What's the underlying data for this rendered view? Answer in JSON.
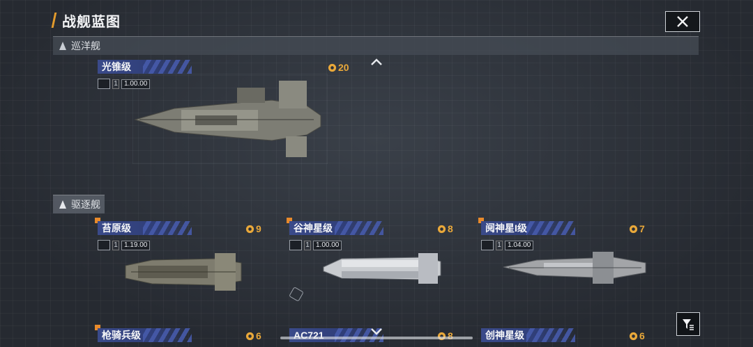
{
  "header": {
    "title": "战舰蓝图"
  },
  "sections": {
    "cruiser": {
      "label": "巡洋舰"
    },
    "destroyer": {
      "label": "驱逐舰"
    }
  },
  "ships": {
    "guangzhui": {
      "name": "光锥级",
      "cost": "20",
      "level": "1",
      "value": "1.00.00"
    },
    "taiyuan": {
      "name": "苔原级",
      "cost": "9",
      "level": "1",
      "value": "1.19.00"
    },
    "gushen": {
      "name": "谷神星级",
      "cost": "8",
      "level": "1",
      "value": "1.00.00"
    },
    "yueshen": {
      "name": "阋神星I级",
      "cost": "7",
      "level": "1",
      "value": "1.04.00"
    },
    "qiangqi": {
      "name": "枪骑兵级",
      "cost": "6"
    },
    "ac721": {
      "name": "AC721",
      "cost": "8"
    },
    "chuangshen": {
      "name": "创神星级",
      "cost": "6"
    }
  },
  "colors": {
    "accent": "#e39b2c",
    "name_tag": "#3a4a8a",
    "background": "#2b3038"
  },
  "icons": {
    "close": "close-icon",
    "filter": "filter-icon",
    "scroll_up": "chevron-up-icon",
    "scroll_down": "chevron-down-icon"
  },
  "scroll": {
    "position_fraction": 0.0
  }
}
